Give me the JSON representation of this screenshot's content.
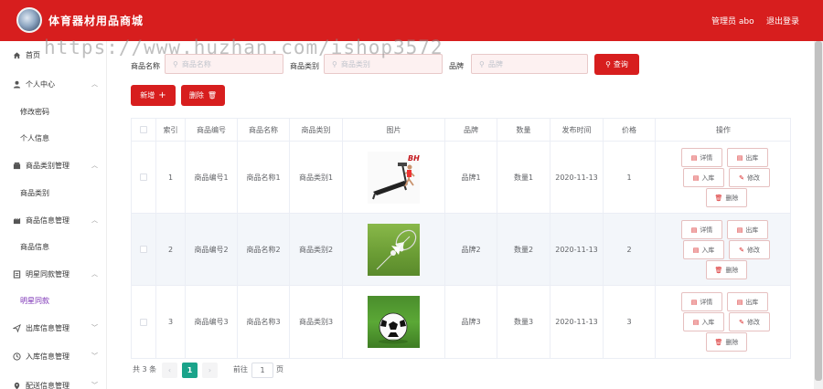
{
  "header": {
    "title": "体育器材用品商城",
    "user": "管理员 abo",
    "logout": "退出登录"
  },
  "watermark": "https://www.huzhan.com/ishop3572",
  "sidebar": {
    "items": [
      {
        "label": "首页",
        "icon": "home-icon"
      },
      {
        "label": "个人中心",
        "icon": "user-icon"
      },
      {
        "label": "修改密码"
      },
      {
        "label": "个人信息"
      },
      {
        "label": "商品类别管理",
        "icon": "category-icon"
      },
      {
        "label": "商品类别"
      },
      {
        "label": "商品信息管理",
        "icon": "goods-icon"
      },
      {
        "label": "商品信息"
      },
      {
        "label": "明星同款管理",
        "icon": "star-icon"
      },
      {
        "label": "明星同款"
      },
      {
        "label": "出库信息管理",
        "icon": "send-icon"
      },
      {
        "label": "入库信息管理",
        "icon": "clock-icon"
      },
      {
        "label": "配送信息管理",
        "icon": "location-icon"
      }
    ]
  },
  "search": {
    "name_label": "商品名称",
    "name_placeholder": "商品名称",
    "category_label": "商品类别",
    "category_placeholder": "商品类别",
    "brand_label": "品牌",
    "brand_placeholder": "品牌",
    "button": "查询"
  },
  "actions": {
    "add": "新增",
    "delete": "删除"
  },
  "table": {
    "headers": [
      "索引",
      "商品编号",
      "商品名称",
      "商品类别",
      "图片",
      "品牌",
      "数量",
      "发布时间",
      "价格",
      "操作"
    ],
    "rows": [
      {
        "index": "1",
        "code": "商品编号1",
        "name": "商品名称1",
        "category": "商品类别1",
        "image": "treadmill",
        "brand": "品牌1",
        "qty": "数量1",
        "date": "2020-11-13",
        "price": "1"
      },
      {
        "index": "2",
        "code": "商品编号2",
        "name": "商品名称2",
        "category": "商品类别2",
        "image": "shuttlecock",
        "brand": "品牌2",
        "qty": "数量2",
        "date": "2020-11-13",
        "price": "2"
      },
      {
        "index": "3",
        "code": "商品编号3",
        "name": "商品名称3",
        "category": "商品类别3",
        "image": "football",
        "brand": "品牌3",
        "qty": "数量3",
        "date": "2020-11-13",
        "price": "3"
      }
    ],
    "ops": {
      "detail": "详情",
      "out": "出库",
      "in": "入库",
      "edit": "修改",
      "delete": "删除"
    },
    "image_brand_text": "BH"
  },
  "pagination": {
    "total": "共 3 条",
    "current": "1",
    "goto": "前往",
    "page_value": "1",
    "page_unit": "页"
  },
  "colors": {
    "primary": "#d71e1e",
    "active_menu": "#7a2fb5",
    "pager_active": "#1aa38a"
  }
}
